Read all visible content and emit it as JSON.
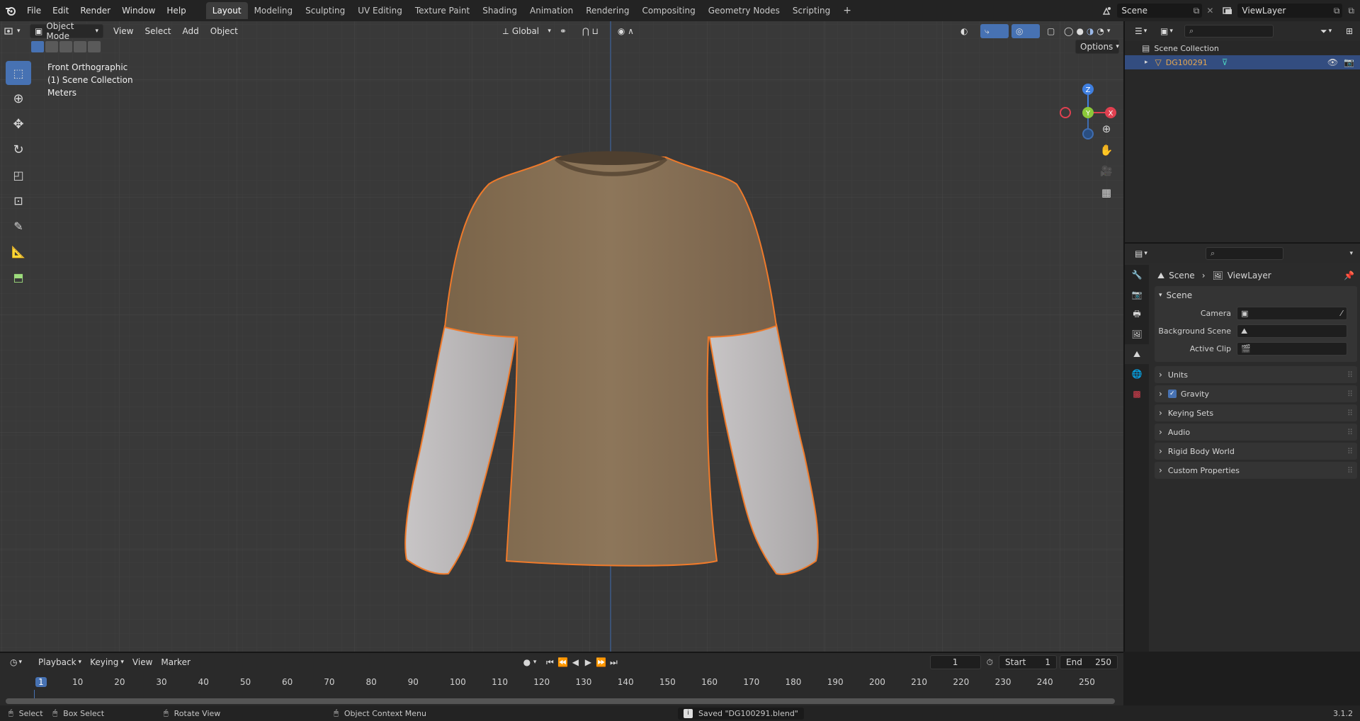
{
  "topbar": {
    "menus": [
      "File",
      "Edit",
      "Render",
      "Window",
      "Help"
    ],
    "workspaces": [
      "Layout",
      "Modeling",
      "Sculpting",
      "UV Editing",
      "Texture Paint",
      "Shading",
      "Animation",
      "Rendering",
      "Compositing",
      "Geometry Nodes",
      "Scripting"
    ],
    "active_workspace": "Layout",
    "add_tab": "+",
    "scene_name": "Scene",
    "view_layer": "ViewLayer"
  },
  "viewport": {
    "mode": "Object Mode",
    "menus": [
      "View",
      "Select",
      "Add",
      "Object"
    ],
    "transform_orientation": "Global",
    "options_label": "Options",
    "view_name": "Front Orthographic",
    "collection_info": "(1) Scene Collection",
    "units": "Meters",
    "axis_labels": {
      "z": "Z",
      "y": "Y",
      "x": "X"
    }
  },
  "outliner": {
    "root": "Scene Collection",
    "object_name": "DG100291"
  },
  "properties": {
    "breadcrumb_scene": "Scene",
    "breadcrumb_layer": "ViewLayer",
    "section": "Scene",
    "fields": [
      {
        "label": "Camera"
      },
      {
        "label": "Background Scene"
      },
      {
        "label": "Active Clip"
      }
    ],
    "panels": [
      "Units",
      "Gravity",
      "Keying Sets",
      "Audio",
      "Rigid Body World",
      "Custom Properties"
    ],
    "gravity_checked": true
  },
  "timeline": {
    "menus": [
      "Playback",
      "Keying",
      "View",
      "Marker"
    ],
    "current_frame": "1",
    "start_label": "Start",
    "start_value": "1",
    "end_label": "End",
    "end_value": "250",
    "ticks": [
      "1",
      "10",
      "20",
      "30",
      "40",
      "50",
      "60",
      "70",
      "80",
      "90",
      "100",
      "110",
      "120",
      "130",
      "140",
      "150",
      "160",
      "170",
      "180",
      "190",
      "200",
      "210",
      "220",
      "230",
      "240",
      "250"
    ]
  },
  "statusbar": {
    "select": "Select",
    "box_select": "Box Select",
    "rotate_view": "Rotate View",
    "context_menu": "Object Context Menu",
    "message": "Saved \"DG100291.blend\"",
    "version": "3.1.2"
  },
  "colors": {
    "accent": "#4772b3",
    "selection_outline": "#f07a2a",
    "shirt": "#8a7358",
    "sleeve": "#bdbabb",
    "object_name": "#e6a850"
  }
}
